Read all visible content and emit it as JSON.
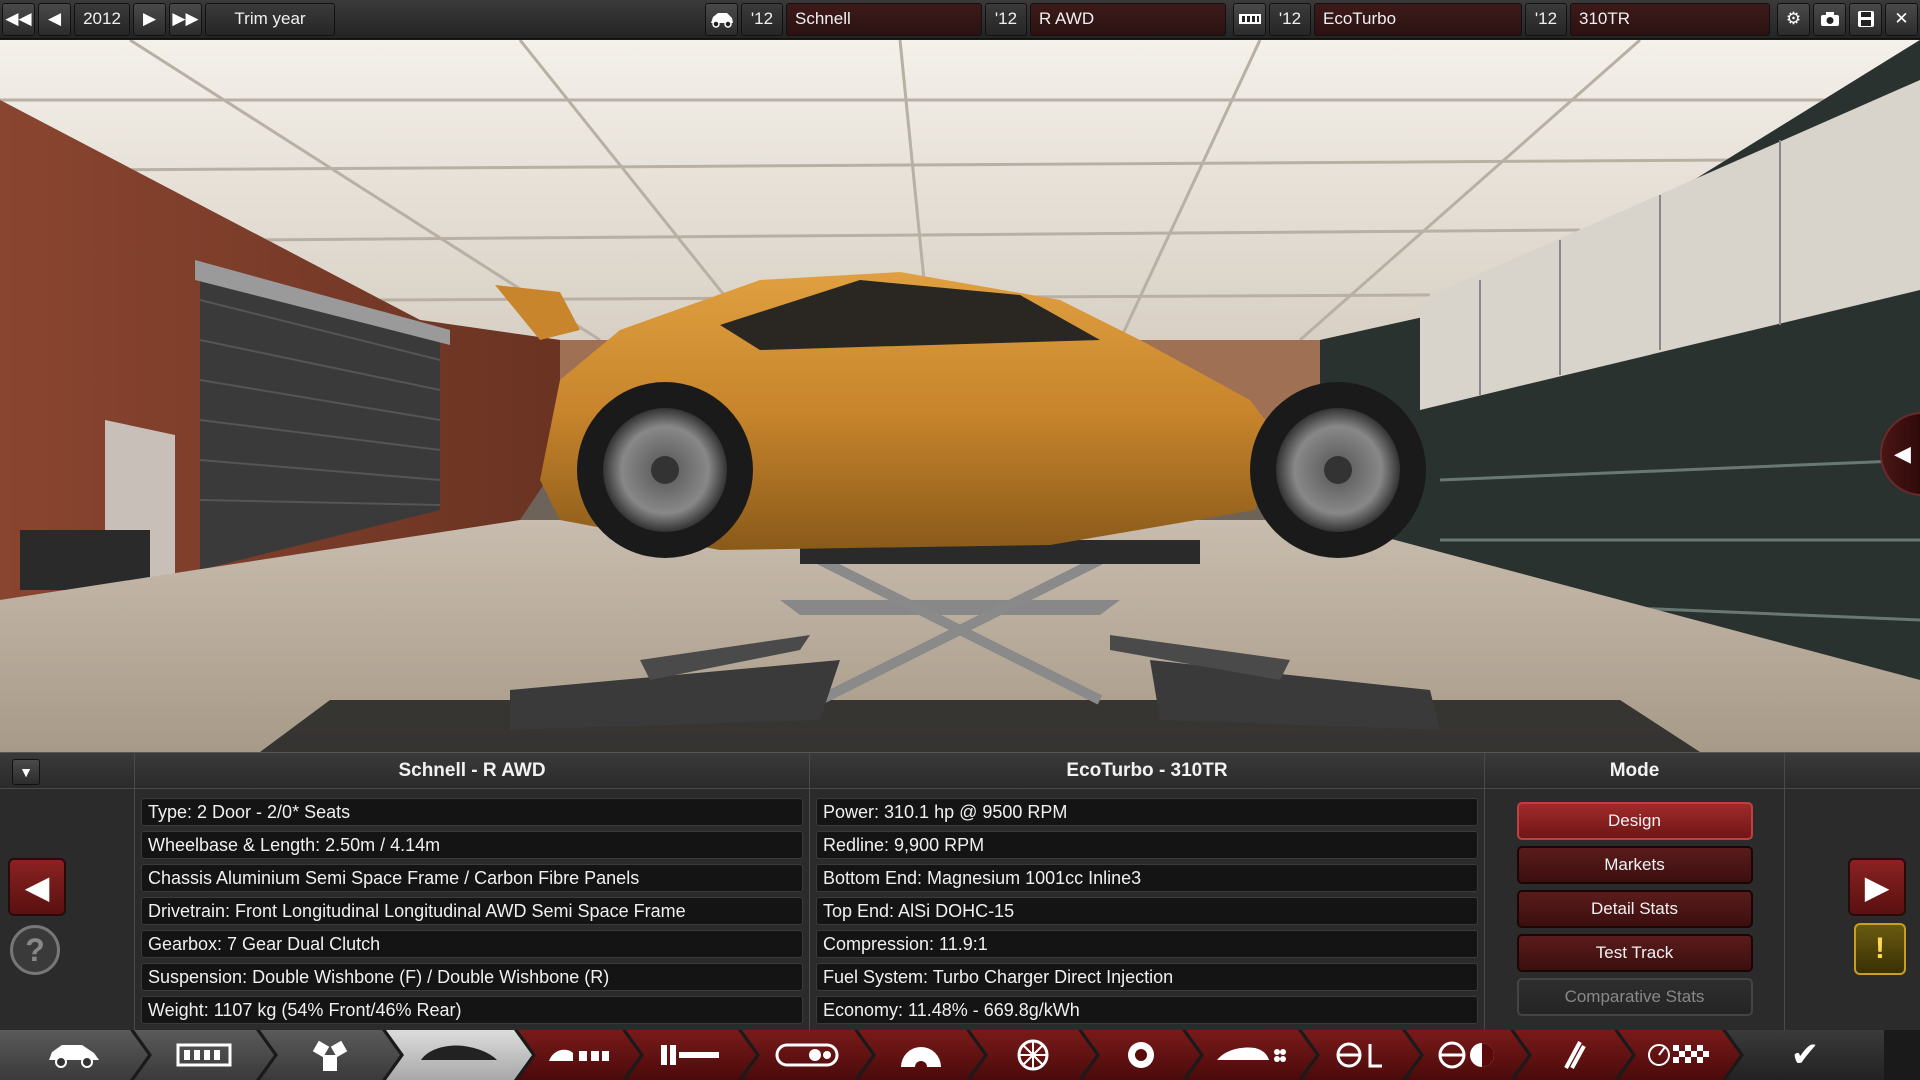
{
  "topbar": {
    "year": "2012",
    "trim_year_label": "Trim year",
    "car_model_year": "'12",
    "car_model_name": "Schnell",
    "car_trim_year": "'12",
    "car_trim_name": "R AWD",
    "engine_model_year": "'12",
    "engine_model_name": "EcoTurbo",
    "engine_variant_year": "'12",
    "engine_variant_name": "310TR"
  },
  "car_panel": {
    "title": "Schnell - R AWD",
    "rows": [
      "Type: 2 Door - 2/0* Seats",
      "Wheelbase & Length: 2.50m / 4.14m",
      "Chassis Aluminium Semi Space Frame / Carbon Fibre Panels",
      "Drivetrain: Front Longitudinal Longitudinal AWD Semi Space Frame",
      "Gearbox: 7 Gear Dual Clutch",
      "Suspension: Double Wishbone (F) / Double Wishbone (R)",
      "Weight: 1107 kg (54% Front/46% Rear)"
    ]
  },
  "engine_panel": {
    "title": "EcoTurbo - 310TR",
    "rows": [
      "Power: 310.1 hp @ 9500 RPM",
      "Redline:  9,900 RPM",
      "Bottom End: Magnesium 1001cc Inline3",
      "Top End: AlSi DOHC-15",
      "Compression: 11.9:1",
      "Fuel System: Turbo Charger Direct Injection",
      "Economy: 11.48% - 669.8g/kWh"
    ]
  },
  "mode_panel": {
    "title": "Mode",
    "buttons": [
      "Design",
      "Markets",
      "Detail Stats",
      "Test Track",
      "Comparative Stats"
    ]
  },
  "colors": {
    "accent_red": "#8a2222",
    "active_red": "#a02a2a",
    "car_orange": "#c88a30",
    "warning_yellow": "#ffd850"
  },
  "nav_icons": [
    "car-icon",
    "chassis-icon",
    "engine-icon",
    "body-icon",
    "seats-icon",
    "interior-icon",
    "drivetrain-icon",
    "suspension-icon",
    "wheel-icon",
    "brake-icon",
    "aero-icon",
    "steering-icon",
    "tuning-icon",
    "tools-icon",
    "testing-icon",
    "finish-check-icon"
  ]
}
